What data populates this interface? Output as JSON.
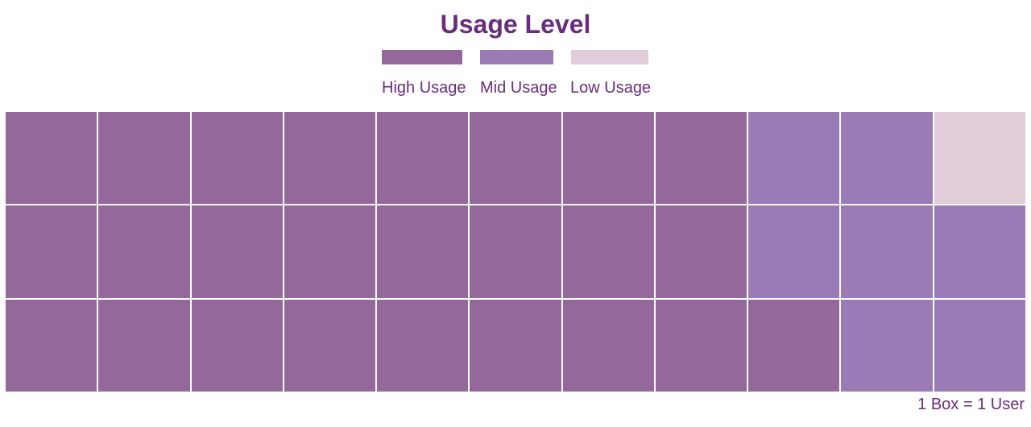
{
  "title": "Usage Level",
  "footnote": "1 Box = 1 User",
  "colors": {
    "high": "#94689a",
    "mid": "#9a7bb5",
    "low": "#e3ccda",
    "text": "#6a2c7d"
  },
  "chart_data": {
    "type": "waffle",
    "title": "Usage Level",
    "unit_note": "1 Box = 1 User",
    "rows": 3,
    "columns": 11,
    "legend": [
      {
        "key": "high",
        "label": "High Usage"
      },
      {
        "key": "mid",
        "label": "Mid Usage"
      },
      {
        "key": "low",
        "label": "Low Usage"
      }
    ],
    "cells": [
      [
        "high",
        "high",
        "high",
        "high",
        "high",
        "high",
        "high",
        "high",
        "mid",
        "mid",
        "low"
      ],
      [
        "high",
        "high",
        "high",
        "high",
        "high",
        "high",
        "high",
        "high",
        "mid",
        "mid",
        "mid"
      ],
      [
        "high",
        "high",
        "high",
        "high",
        "high",
        "high",
        "high",
        "high",
        "high",
        "mid",
        "mid"
      ]
    ],
    "counts": {
      "high": 25,
      "mid": 7,
      "low": 1
    }
  }
}
